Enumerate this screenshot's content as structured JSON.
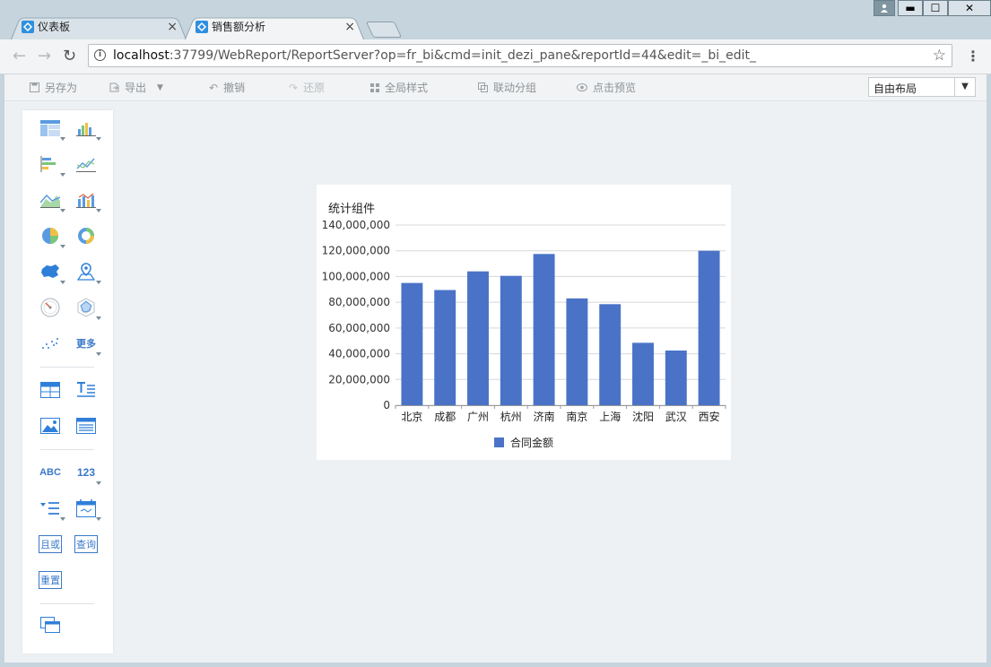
{
  "browser": {
    "tabs": [
      {
        "title": "仪表板",
        "close": "×",
        "active": false
      },
      {
        "title": "销售额分析",
        "close": "×",
        "active": true
      }
    ],
    "url_host": "localhost",
    "url_rest": ":37799/WebReport/ReportServer?op=fr_bi&cmd=init_dezi_pane&reportId=44&edit=_bi_edit_",
    "window_controls": {
      "minimize": "▬",
      "maximize": "☐",
      "close": "✕"
    }
  },
  "toolbar": {
    "save_as": "另存为",
    "export": "导出",
    "export_arrow": "▼",
    "undo": "撤销",
    "redo": "还原",
    "global_style": "全局样式",
    "linkage_group": "联动分组",
    "click_preview": "点击预览",
    "layout_value": "自由布局",
    "layout_arrow": "▼"
  },
  "palette": {
    "more_label": "更多",
    "abc_label": "ABC",
    "num_label": "123",
    "or_label": "且或",
    "query_label": "查询",
    "reset_label": "重置"
  },
  "colors": {
    "bar": "#4a73c8",
    "accent": "#3a78c9"
  },
  "chart_data": {
    "type": "bar",
    "title": "统计组件",
    "categories": [
      "北京",
      "成都",
      "广州",
      "杭州",
      "济南",
      "南京",
      "上海",
      "沈阳",
      "武汉",
      "西安"
    ],
    "series": [
      {
        "name": "合同金额",
        "values": [
          95000000,
          89500000,
          104000000,
          100500000,
          117500000,
          83000000,
          78500000,
          48500000,
          42500000,
          120000000
        ]
      }
    ],
    "ylim": [
      0,
      140000000
    ],
    "yticks": [
      "0",
      "20,000,000",
      "40,000,000",
      "60,000,000",
      "80,000,000",
      "100,000,000",
      "120,000,000",
      "140,000,000"
    ],
    "grid": true,
    "legend": "bottom"
  }
}
